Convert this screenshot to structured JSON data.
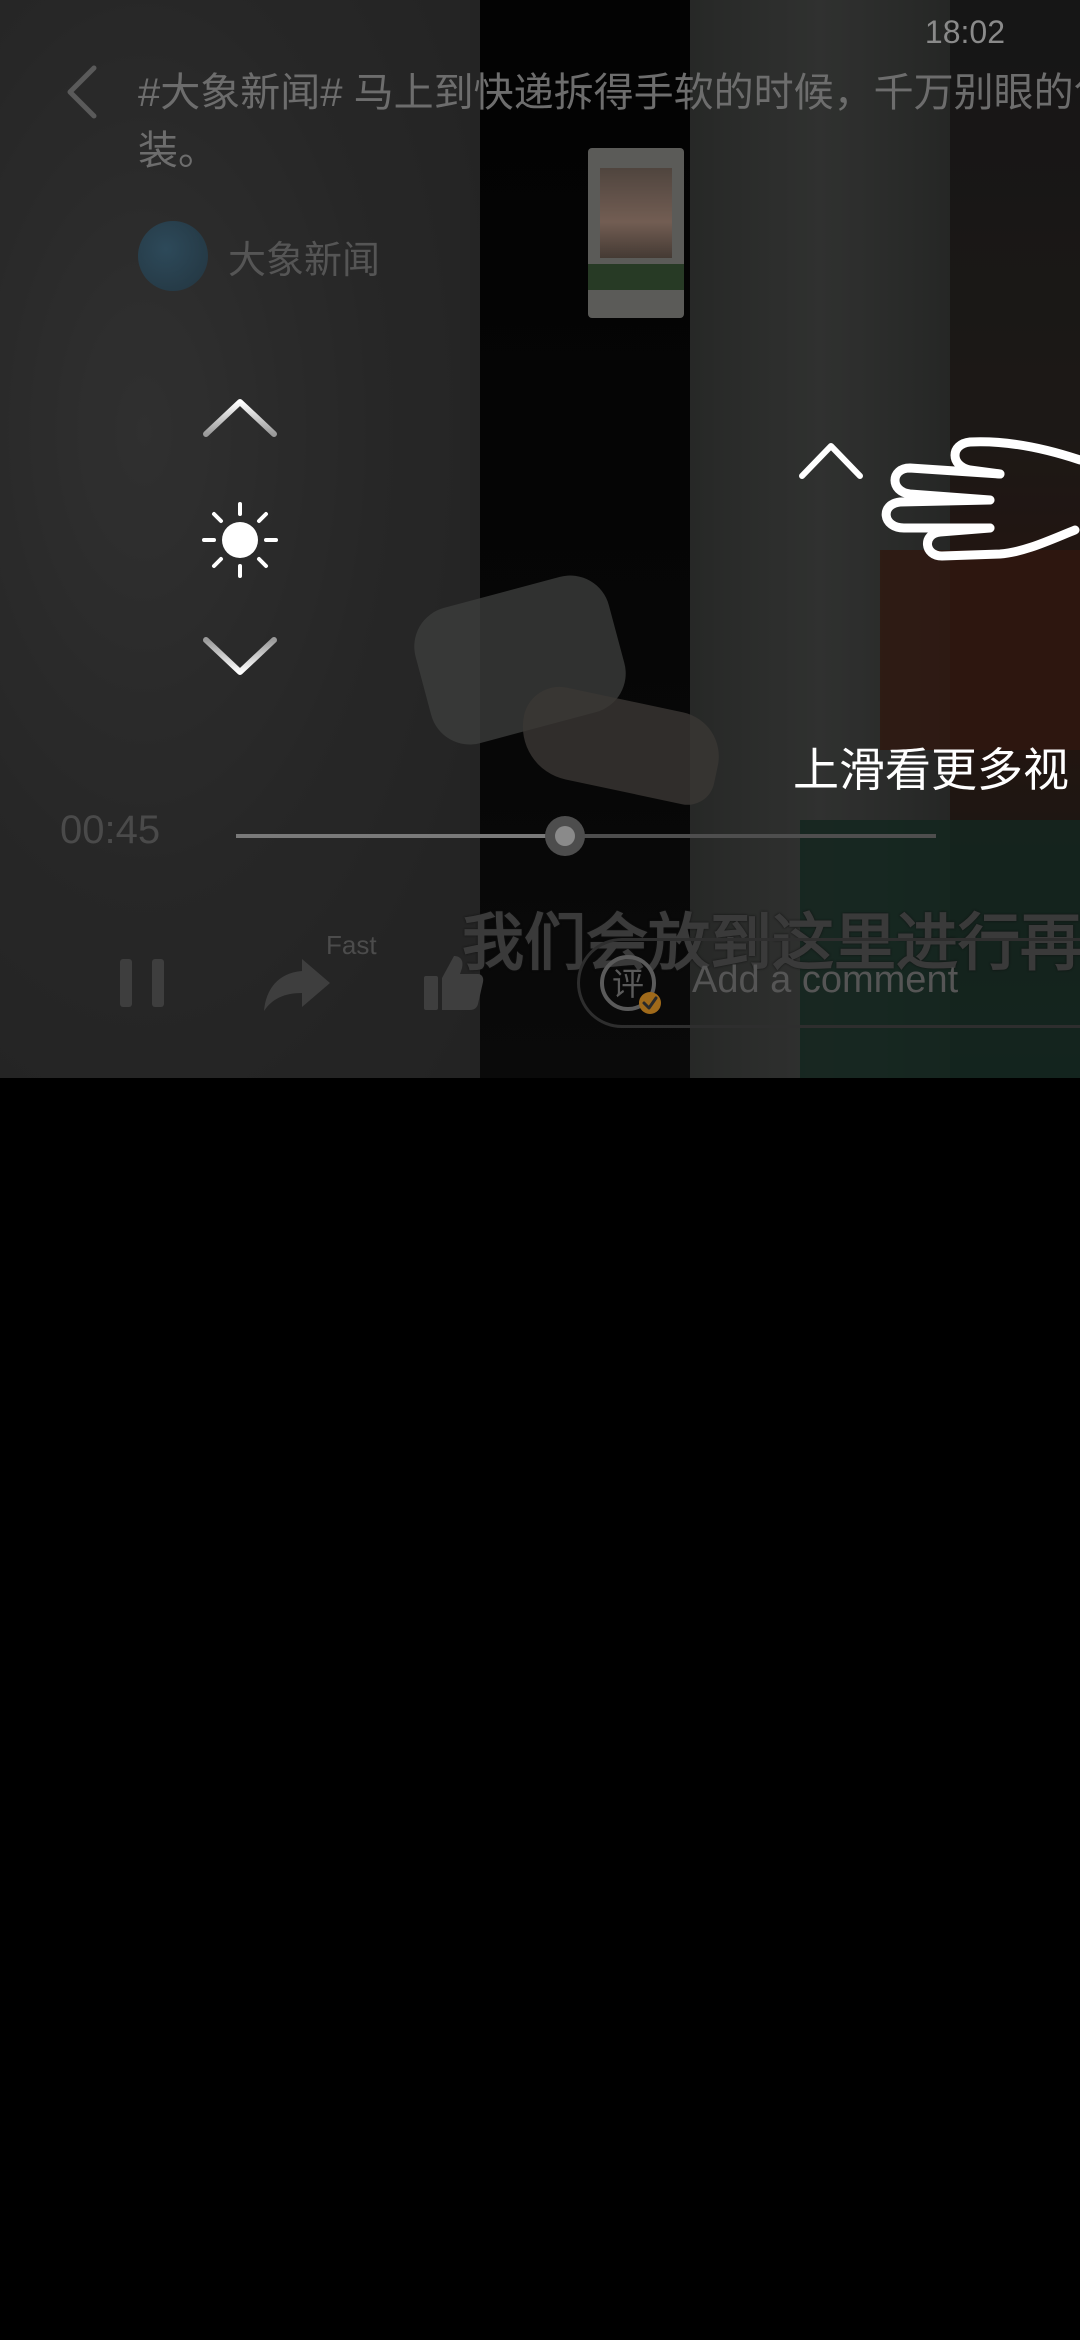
{
  "status_bar": {
    "time": "18:02"
  },
  "header": {
    "headline": "#大象新闻# 马上到快递拆得手软的时候，千万别眼的包装。",
    "author_name": "大象新闻"
  },
  "swipe_hint": {
    "text": "上滑看更多视"
  },
  "player": {
    "current_time": "00:45",
    "progress": 0.47,
    "subtitle": "我们会放到这里进行再",
    "fast_label": "Fast"
  },
  "comment": {
    "placeholder": "Add a comment"
  },
  "icons": {
    "back": "back-arrow-icon",
    "brightness_up": "chevron-up-icon",
    "brightness": "sun-icon",
    "brightness_down": "chevron-down-icon",
    "swipe_arrow": "arrow-up-icon",
    "swipe_hand": "hand-pointer-icon",
    "pause": "pause-icon",
    "share": "share-icon",
    "like": "thumbs-up-icon",
    "comment": "comment-icon"
  }
}
